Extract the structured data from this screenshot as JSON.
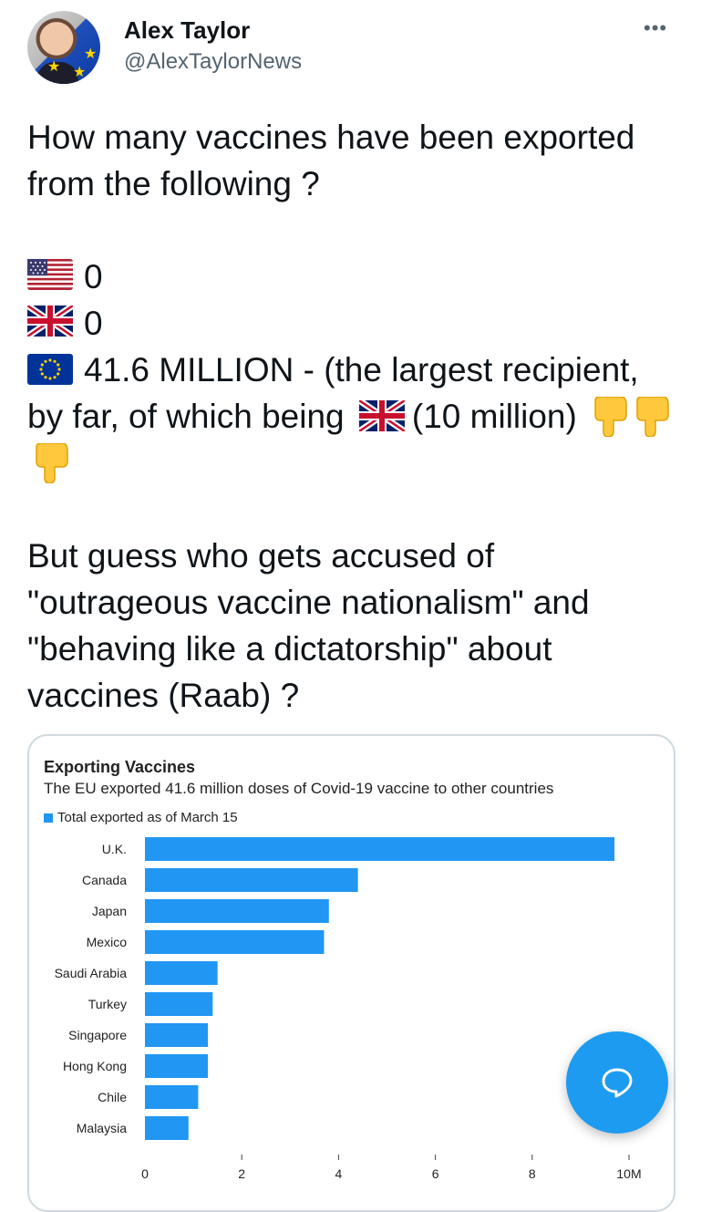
{
  "author": {
    "name": "Alex Taylor",
    "handle": "@AlexTaylorNews"
  },
  "tweet": {
    "intro": "How many vaccines have been exported from the following ?",
    "us_value": "0",
    "uk_value": "0",
    "eu_value": "41.6 MILLION - (the largest recipient, by far, of which being",
    "eu_suffix": "(10 million)",
    "closing": "But guess who gets accused of \"outrageous vaccine nationalism\" and \"behaving like a dictatorship\" about vaccines (Raab) ?"
  },
  "icons": {
    "more": "more-options-icon",
    "us_flag": "us-flag-icon",
    "uk_flag": "uk-flag-icon",
    "eu_flag": "eu-flag-icon",
    "pointing_down": "backhand-index-pointing-down-icon",
    "compose": "compose-reply-icon"
  },
  "colors": {
    "bar": "#2196f3",
    "accent": "#1d9bf0"
  },
  "chart_data": {
    "type": "bar",
    "orientation": "horizontal",
    "title": "Exporting Vaccines",
    "subtitle": "The EU exported 41.6 million doses of Covid-19 vaccine to other countries",
    "legend": "Total exported as of March 15",
    "categories": [
      "U.K.",
      "Canada",
      "Japan",
      "Mexico",
      "Saudi Arabia",
      "Turkey",
      "Singapore",
      "Hong Kong",
      "Chile",
      "Malaysia"
    ],
    "values": [
      9.7,
      4.4,
      3.8,
      3.7,
      1.5,
      1.4,
      1.3,
      1.3,
      1.1,
      0.9
    ],
    "x_ticks": [
      "0",
      "2",
      "4",
      "6",
      "8",
      "10M"
    ],
    "xlim": [
      0,
      10
    ],
    "grid": false
  }
}
